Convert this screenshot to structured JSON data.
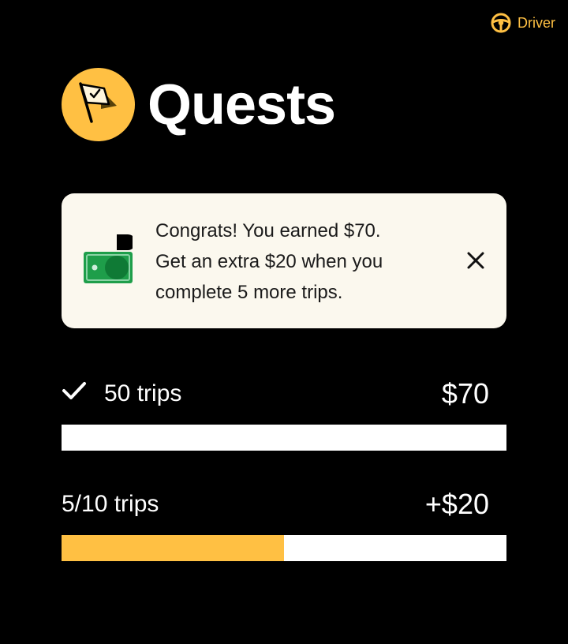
{
  "driver_badge": {
    "label": "Driver",
    "icon": "steering-wheel-icon",
    "color": "#FFC043"
  },
  "header": {
    "title": "Quests",
    "icon": "flag-icon",
    "badge_color": "#FFC043"
  },
  "banner": {
    "icon": "cash-icon",
    "lines": [
      "Congrats! You earned $70.",
      "Get an extra $20 when you",
      "complete 5 more trips."
    ],
    "close_icon": "close-icon"
  },
  "milestones": [
    {
      "label": "50 trips",
      "amount": "$70",
      "completed": true,
      "progress": 1.0
    },
    {
      "label": "5/10 trips",
      "amount": "+$20",
      "completed": false,
      "progress": 0.5
    }
  ],
  "colors": {
    "accent": "#FFC043",
    "background": "#000000",
    "banner_bg": "#FBF8EE",
    "track": "#FFFFFF",
    "cash_green": "#1E9E4A"
  }
}
